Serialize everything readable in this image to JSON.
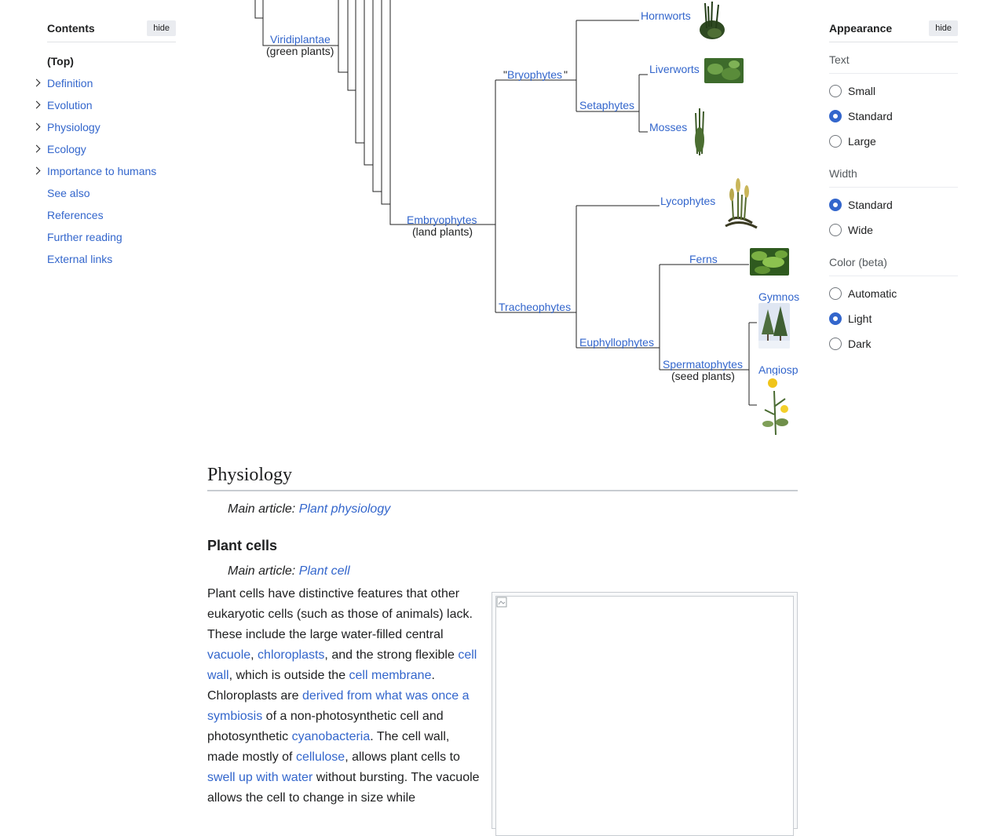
{
  "toc": {
    "title": "Contents",
    "hide_label": "hide",
    "items": [
      {
        "label": "(Top)"
      },
      {
        "label": "Definition"
      },
      {
        "label": "Evolution"
      },
      {
        "label": "Physiology"
      },
      {
        "label": "Ecology"
      },
      {
        "label": "Importance to humans"
      },
      {
        "label": "See also"
      },
      {
        "label": "References"
      },
      {
        "label": "Further reading"
      },
      {
        "label": "External links"
      }
    ]
  },
  "appearance": {
    "title": "Appearance",
    "hide_label": "hide",
    "text_group": {
      "title": "Text",
      "options": [
        "Small",
        "Standard",
        "Large"
      ],
      "selected": "Standard"
    },
    "width_group": {
      "title": "Width",
      "options": [
        "Standard",
        "Wide"
      ],
      "selected": "Standard"
    },
    "color_group": {
      "title": "Color (beta)",
      "options": [
        "Automatic",
        "Light",
        "Dark"
      ],
      "selected": "Light"
    }
  },
  "cladogram": {
    "viridiplantae": "Viridiplantae",
    "viridiplantae_sub": "(green plants)",
    "embryophytes": "Embryophytes",
    "embryophytes_sub": "(land plants)",
    "bryophytes": "Bryophytes",
    "bryophytes_quote_open": "\"",
    "bryophytes_quote_close": "\"",
    "hornworts": "Hornworts",
    "setaphytes": "Setaphytes",
    "liverworts": "Liverworts",
    "mosses": "Mosses",
    "tracheophytes": "Tracheophytes",
    "lycophytes": "Lycophytes",
    "euphyllophytes": "Euphyllophytes",
    "ferns": "Ferns",
    "spermatophytes": "Spermatophytes",
    "spermatophytes_sub": "(seed plants)",
    "gymnosperms": "Gymnos",
    "angiosperms": "Angiosp"
  },
  "article": {
    "section_title": "Physiology",
    "hatnote_prefix": "Main article: ",
    "main_article_link": "Plant physiology",
    "subsection_title": "Plant cells",
    "sub_main_article_link": "Plant cell",
    "para": {
      "t1": "Plant cells have distinctive features that other eukaryotic cells (such as those of animals) lack. These include the large water-filled central ",
      "l1": "vacuole",
      "t2": ", ",
      "l2": "chloroplasts",
      "t3": ", and the strong flexible ",
      "l3": "cell wall",
      "t4": ", which is outside the ",
      "l4": "cell membrane",
      "t5": ". Chloroplasts are ",
      "l5": "derived from what was once a symbiosis",
      "t6": " of a non-photosynthetic cell and photosynthetic ",
      "l6": "cyanobacteria",
      "t7": ". The cell wall, made mostly of ",
      "l7": "cellulose",
      "t8": ", allows plant cells to ",
      "l8": "swell up with water",
      "t9": " without bursting. The vacuole allows the cell to change in size while"
    }
  },
  "colors": {
    "link": "#3366cc",
    "text": "#202122",
    "radio_selected": "#3366cc"
  }
}
